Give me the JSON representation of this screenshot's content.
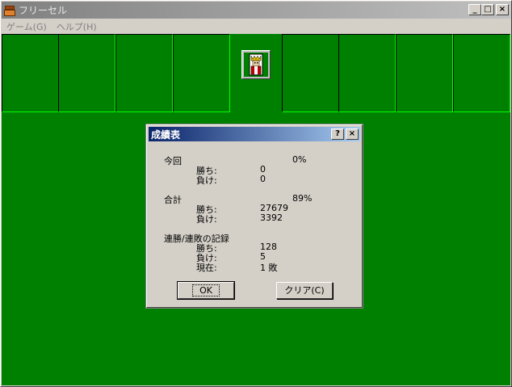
{
  "window": {
    "title": "フリーセル",
    "min_label": "_",
    "max_label": "□",
    "close_label": "×"
  },
  "menu": {
    "game": "ゲーム(G)",
    "help": "ヘルプ(H)"
  },
  "dialog": {
    "title": "成績表",
    "help_label": "?",
    "close_label": "×",
    "this_session": {
      "heading": "今回",
      "percent": "0%",
      "wins_label": "勝ち:",
      "wins": "0",
      "losses_label": "負け:",
      "losses": "0"
    },
    "total": {
      "heading": "合計",
      "percent": "89%",
      "wins_label": "勝ち:",
      "wins": "27679",
      "losses_label": "負け:",
      "losses": "3392"
    },
    "streaks": {
      "heading": "連勝/連敗の記録",
      "wins_label": "勝ち:",
      "wins": "128",
      "losses_label": "負け:",
      "losses": "5",
      "current_label": "現在:",
      "current": "1 敗"
    },
    "ok_label": "OK",
    "clear_label": "クリア(C)"
  },
  "colors": {
    "felt": "#008000",
    "cell_highlight": "#00ff00",
    "dialog_title_start": "#0a246a",
    "dialog_title_end": "#a6caf0"
  }
}
